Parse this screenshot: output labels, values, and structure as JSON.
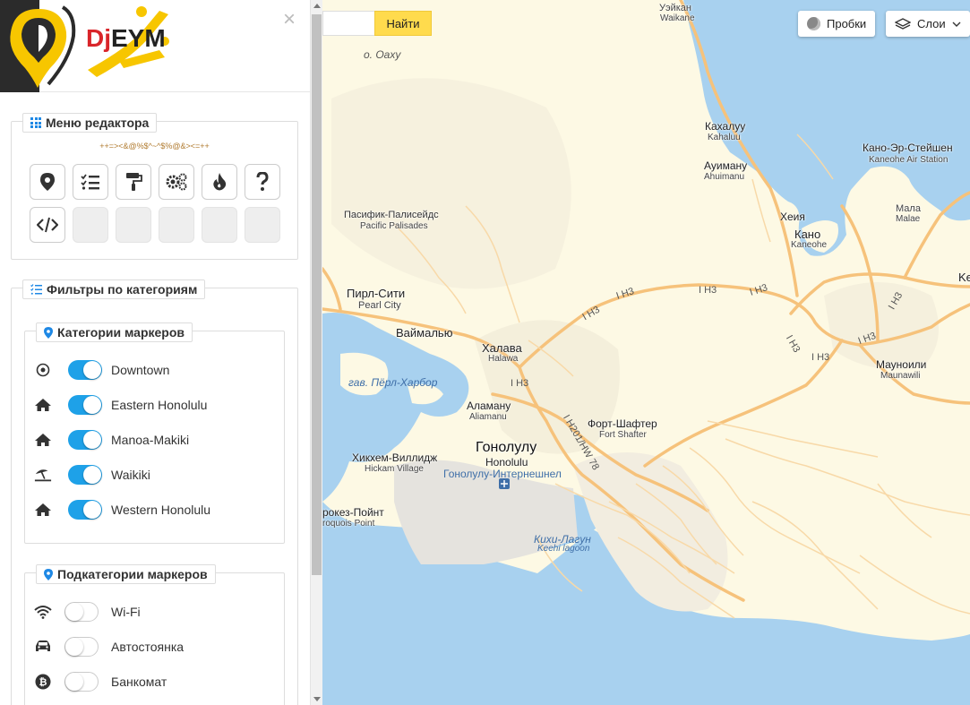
{
  "header": {
    "logo_text_a": "Dj",
    "logo_text_b": "EYM",
    "close": "×"
  },
  "editor_menu": {
    "title": "Меню редактора",
    "encoded_string": "++=><&@%$^~^$%@&><=++",
    "tools": [
      "marker-icon",
      "checklist-icon",
      "paint-roller-icon",
      "gears-icon",
      "fire-icon",
      "question-icon",
      "code-icon",
      "",
      "",
      "",
      "",
      ""
    ]
  },
  "filters": {
    "title": "Фильтры по категориям",
    "categories_title": "Категории маркеров",
    "categories": [
      {
        "label": "Downtown",
        "icon": "dot-circle-icon",
        "on": true
      },
      {
        "label": "Eastern Honolulu",
        "icon": "home-icon",
        "on": true
      },
      {
        "label": "Manoa-Makiki",
        "icon": "home-icon",
        "on": true
      },
      {
        "label": "Waikiki",
        "icon": "beach-umbrella-icon",
        "on": true
      },
      {
        "label": "Western Honolulu",
        "icon": "home-icon",
        "on": true
      }
    ],
    "subcategories_title": "Подкатегории маркеров",
    "subcategories": [
      {
        "label": "Wi-Fi",
        "icon": "wifi-icon",
        "on": false
      },
      {
        "label": "Автостоянка",
        "icon": "car-icon",
        "on": false
      },
      {
        "label": "Банкомат",
        "icon": "bitcoin-icon",
        "on": false
      }
    ]
  },
  "map": {
    "search_button": "Найти",
    "traffic_button": "Пробки",
    "layers_button": "Слои",
    "labels": {
      "waikane_ru": "Уэйкан",
      "waikane_en": "Waikane",
      "oahu": "о. Оаху",
      "kahaluu_ru": "Кахалуу",
      "kahaluu_en": "Kahaluu",
      "ahuimanu_ru": "Ауиману",
      "ahuimanu_en": "Ahuimanu",
      "mcbh_ru": "Кано-Эр-Стейшен",
      "mcbh_en": "Kaneohe Air Station",
      "palisades_ru": "Пасифик-Палисейдс",
      "palisades_en": "Pacific Palisades",
      "heeia": "Хеия",
      "kaneohe_ru": "Кано",
      "kaneohe_en": "Kaneohe",
      "mala_ru": "Мала",
      "mala_en": "Malae",
      "ke": "Ke",
      "pearl_city_ru": "Пирл-Сити",
      "pearl_city_en": "Pearl City",
      "waimalu": "Ваймалью",
      "halawa_ru": "Халава",
      "halawa_en": "Halawa",
      "maunawili_ru": "Мауноили",
      "maunawili_en": "Maunawili",
      "pearl_harbor": "гав. Пёрл-Харбор",
      "aliamanu_ru": "Аламану",
      "aliamanu_en": "Aliamanu",
      "fort_shafter_ru": "Форт-Шафтер",
      "fort_shafter_en": "Fort Shafter",
      "honolulu_ru": "Гонолулу",
      "honolulu_en": "Honolulu",
      "hickam_ru": "Хикхем-Виллидж",
      "hickam_en": "Hickam Village",
      "airport": "Гонолулу-Интернешнел",
      "iroquois_ru": "рокез-Пойнт",
      "iroquois_en": "roquois Point",
      "keehi_ru": "Кихи-Лагун",
      "keehi_en": "Keehi lagoon",
      "h3": "I H3",
      "h201": "I H201/HW 78"
    }
  }
}
